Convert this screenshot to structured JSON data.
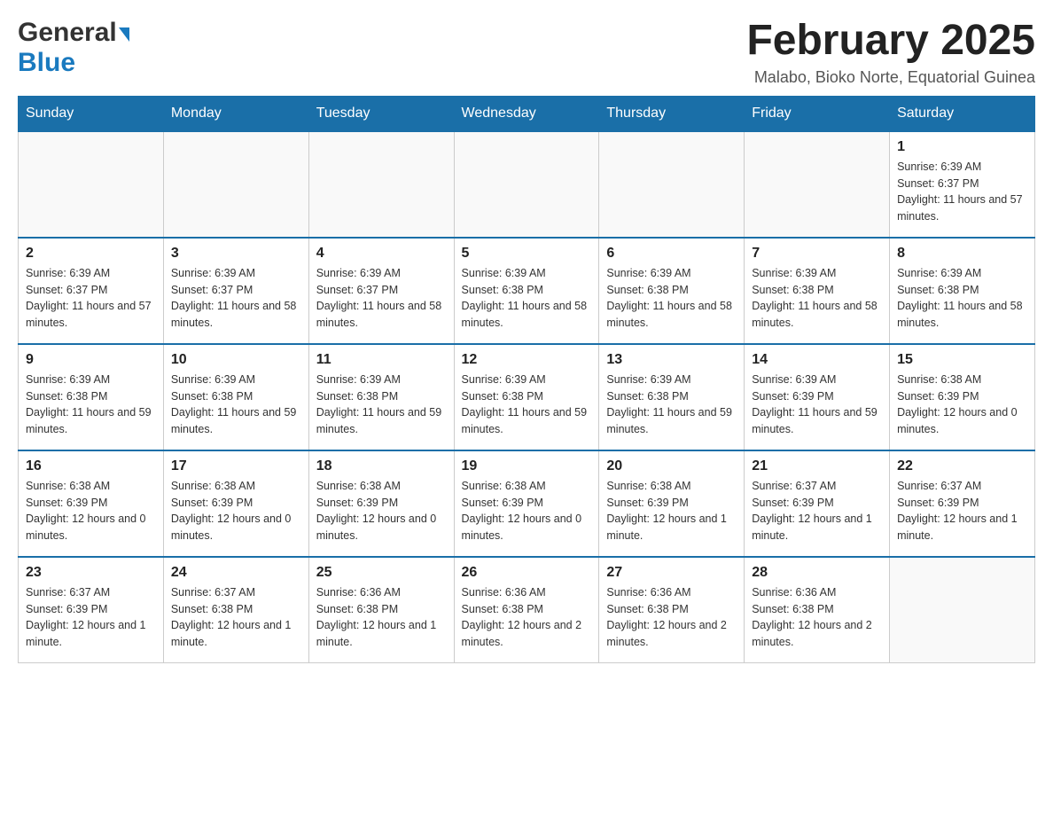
{
  "header": {
    "logo_general": "General",
    "logo_blue": "Blue",
    "month_title": "February 2025",
    "location": "Malabo, Bioko Norte, Equatorial Guinea"
  },
  "days_of_week": [
    "Sunday",
    "Monday",
    "Tuesday",
    "Wednesday",
    "Thursday",
    "Friday",
    "Saturday"
  ],
  "weeks": [
    {
      "days": [
        {
          "date": "",
          "sunrise": "",
          "sunset": "",
          "daylight": ""
        },
        {
          "date": "",
          "sunrise": "",
          "sunset": "",
          "daylight": ""
        },
        {
          "date": "",
          "sunrise": "",
          "sunset": "",
          "daylight": ""
        },
        {
          "date": "",
          "sunrise": "",
          "sunset": "",
          "daylight": ""
        },
        {
          "date": "",
          "sunrise": "",
          "sunset": "",
          "daylight": ""
        },
        {
          "date": "",
          "sunrise": "",
          "sunset": "",
          "daylight": ""
        },
        {
          "date": "1",
          "sunrise": "Sunrise: 6:39 AM",
          "sunset": "Sunset: 6:37 PM",
          "daylight": "Daylight: 11 hours and 57 minutes."
        }
      ]
    },
    {
      "days": [
        {
          "date": "2",
          "sunrise": "Sunrise: 6:39 AM",
          "sunset": "Sunset: 6:37 PM",
          "daylight": "Daylight: 11 hours and 57 minutes."
        },
        {
          "date": "3",
          "sunrise": "Sunrise: 6:39 AM",
          "sunset": "Sunset: 6:37 PM",
          "daylight": "Daylight: 11 hours and 58 minutes."
        },
        {
          "date": "4",
          "sunrise": "Sunrise: 6:39 AM",
          "sunset": "Sunset: 6:37 PM",
          "daylight": "Daylight: 11 hours and 58 minutes."
        },
        {
          "date": "5",
          "sunrise": "Sunrise: 6:39 AM",
          "sunset": "Sunset: 6:38 PM",
          "daylight": "Daylight: 11 hours and 58 minutes."
        },
        {
          "date": "6",
          "sunrise": "Sunrise: 6:39 AM",
          "sunset": "Sunset: 6:38 PM",
          "daylight": "Daylight: 11 hours and 58 minutes."
        },
        {
          "date": "7",
          "sunrise": "Sunrise: 6:39 AM",
          "sunset": "Sunset: 6:38 PM",
          "daylight": "Daylight: 11 hours and 58 minutes."
        },
        {
          "date": "8",
          "sunrise": "Sunrise: 6:39 AM",
          "sunset": "Sunset: 6:38 PM",
          "daylight": "Daylight: 11 hours and 58 minutes."
        }
      ]
    },
    {
      "days": [
        {
          "date": "9",
          "sunrise": "Sunrise: 6:39 AM",
          "sunset": "Sunset: 6:38 PM",
          "daylight": "Daylight: 11 hours and 59 minutes."
        },
        {
          "date": "10",
          "sunrise": "Sunrise: 6:39 AM",
          "sunset": "Sunset: 6:38 PM",
          "daylight": "Daylight: 11 hours and 59 minutes."
        },
        {
          "date": "11",
          "sunrise": "Sunrise: 6:39 AM",
          "sunset": "Sunset: 6:38 PM",
          "daylight": "Daylight: 11 hours and 59 minutes."
        },
        {
          "date": "12",
          "sunrise": "Sunrise: 6:39 AM",
          "sunset": "Sunset: 6:38 PM",
          "daylight": "Daylight: 11 hours and 59 minutes."
        },
        {
          "date": "13",
          "sunrise": "Sunrise: 6:39 AM",
          "sunset": "Sunset: 6:38 PM",
          "daylight": "Daylight: 11 hours and 59 minutes."
        },
        {
          "date": "14",
          "sunrise": "Sunrise: 6:39 AM",
          "sunset": "Sunset: 6:39 PM",
          "daylight": "Daylight: 11 hours and 59 minutes."
        },
        {
          "date": "15",
          "sunrise": "Sunrise: 6:38 AM",
          "sunset": "Sunset: 6:39 PM",
          "daylight": "Daylight: 12 hours and 0 minutes."
        }
      ]
    },
    {
      "days": [
        {
          "date": "16",
          "sunrise": "Sunrise: 6:38 AM",
          "sunset": "Sunset: 6:39 PM",
          "daylight": "Daylight: 12 hours and 0 minutes."
        },
        {
          "date": "17",
          "sunrise": "Sunrise: 6:38 AM",
          "sunset": "Sunset: 6:39 PM",
          "daylight": "Daylight: 12 hours and 0 minutes."
        },
        {
          "date": "18",
          "sunrise": "Sunrise: 6:38 AM",
          "sunset": "Sunset: 6:39 PM",
          "daylight": "Daylight: 12 hours and 0 minutes."
        },
        {
          "date": "19",
          "sunrise": "Sunrise: 6:38 AM",
          "sunset": "Sunset: 6:39 PM",
          "daylight": "Daylight: 12 hours and 0 minutes."
        },
        {
          "date": "20",
          "sunrise": "Sunrise: 6:38 AM",
          "sunset": "Sunset: 6:39 PM",
          "daylight": "Daylight: 12 hours and 1 minute."
        },
        {
          "date": "21",
          "sunrise": "Sunrise: 6:37 AM",
          "sunset": "Sunset: 6:39 PM",
          "daylight": "Daylight: 12 hours and 1 minute."
        },
        {
          "date": "22",
          "sunrise": "Sunrise: 6:37 AM",
          "sunset": "Sunset: 6:39 PM",
          "daylight": "Daylight: 12 hours and 1 minute."
        }
      ]
    },
    {
      "days": [
        {
          "date": "23",
          "sunrise": "Sunrise: 6:37 AM",
          "sunset": "Sunset: 6:39 PM",
          "daylight": "Daylight: 12 hours and 1 minute."
        },
        {
          "date": "24",
          "sunrise": "Sunrise: 6:37 AM",
          "sunset": "Sunset: 6:38 PM",
          "daylight": "Daylight: 12 hours and 1 minute."
        },
        {
          "date": "25",
          "sunrise": "Sunrise: 6:36 AM",
          "sunset": "Sunset: 6:38 PM",
          "daylight": "Daylight: 12 hours and 1 minute."
        },
        {
          "date": "26",
          "sunrise": "Sunrise: 6:36 AM",
          "sunset": "Sunset: 6:38 PM",
          "daylight": "Daylight: 12 hours and 2 minutes."
        },
        {
          "date": "27",
          "sunrise": "Sunrise: 6:36 AM",
          "sunset": "Sunset: 6:38 PM",
          "daylight": "Daylight: 12 hours and 2 minutes."
        },
        {
          "date": "28",
          "sunrise": "Sunrise: 6:36 AM",
          "sunset": "Sunset: 6:38 PM",
          "daylight": "Daylight: 12 hours and 2 minutes."
        },
        {
          "date": "",
          "sunrise": "",
          "sunset": "",
          "daylight": ""
        }
      ]
    }
  ]
}
